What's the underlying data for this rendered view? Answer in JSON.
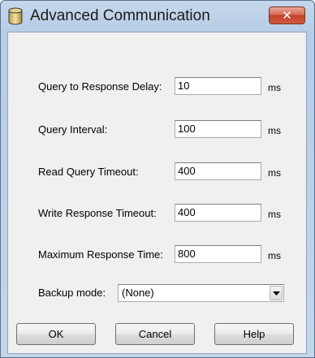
{
  "window": {
    "title": "Advanced Communication",
    "icon": "cylinder-database-icon",
    "close_symbol": "✕"
  },
  "fields": [
    {
      "label": "Query to Response Delay:",
      "value": "10",
      "unit": "ms"
    },
    {
      "label": "Query Interval:",
      "value": "100",
      "unit": "ms"
    },
    {
      "label": "Read Query Timeout:",
      "value": "400",
      "unit": "ms"
    },
    {
      "label": "Write Response Timeout:",
      "value": "400",
      "unit": "ms"
    },
    {
      "label": "Maximum Response Time:",
      "value": "800",
      "unit": "ms"
    }
  ],
  "backup": {
    "label": "Backup mode:",
    "selected": "(None)"
  },
  "buttons": {
    "ok": "OK",
    "cancel": "Cancel",
    "help": "Help"
  },
  "colors": {
    "titlebar": "#c4d7ec",
    "client_bg": "#f0f0f0",
    "close_button": "#c3432b"
  }
}
